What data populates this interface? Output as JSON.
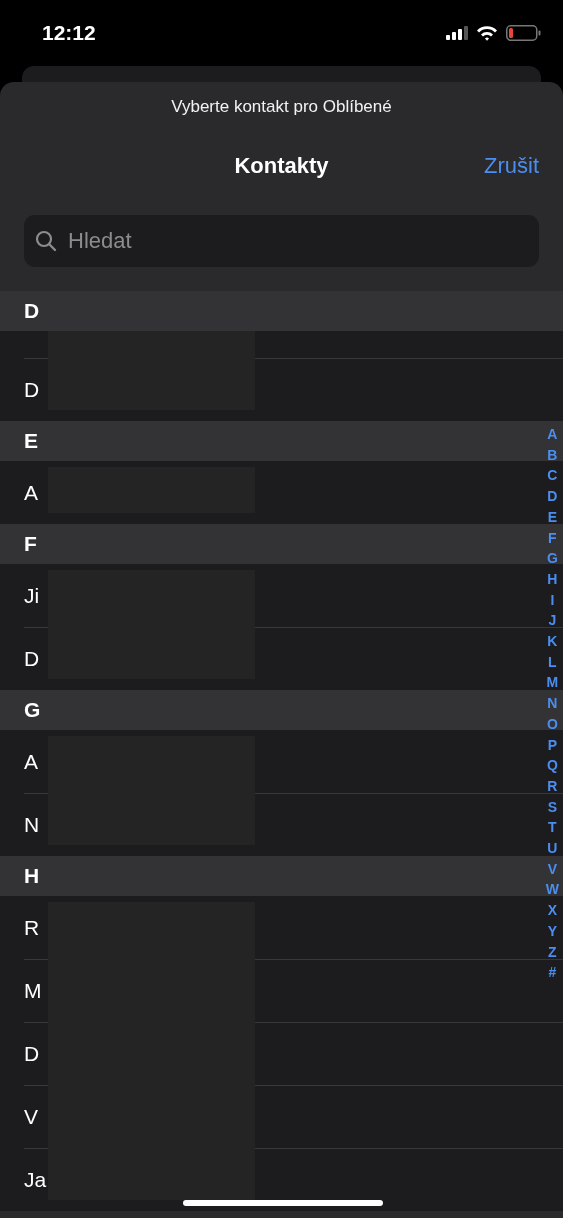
{
  "status_bar": {
    "time": "12:12"
  },
  "sheet": {
    "prompt": "Vyberte kontakt pro Oblíbené",
    "title": "Kontakty",
    "cancel": "Zrušit"
  },
  "search": {
    "placeholder": "Hledat"
  },
  "sections": [
    {
      "letter": "D",
      "rows": [
        "D"
      ]
    },
    {
      "letter": "E",
      "rows": [
        "A"
      ]
    },
    {
      "letter": "F",
      "rows": [
        "Ji",
        "D"
      ]
    },
    {
      "letter": "G",
      "rows": [
        "A",
        "N"
      ]
    },
    {
      "letter": "H",
      "rows": [
        "R",
        "M",
        "D",
        "V",
        "Ja"
      ]
    }
  ],
  "index": [
    "A",
    "B",
    "C",
    "D",
    "E",
    "F",
    "G",
    "H",
    "I",
    "J",
    "K",
    "L",
    "M",
    "N",
    "O",
    "P",
    "Q",
    "R",
    "S",
    "T",
    "U",
    "V",
    "W",
    "X",
    "Y",
    "Z",
    "#"
  ]
}
